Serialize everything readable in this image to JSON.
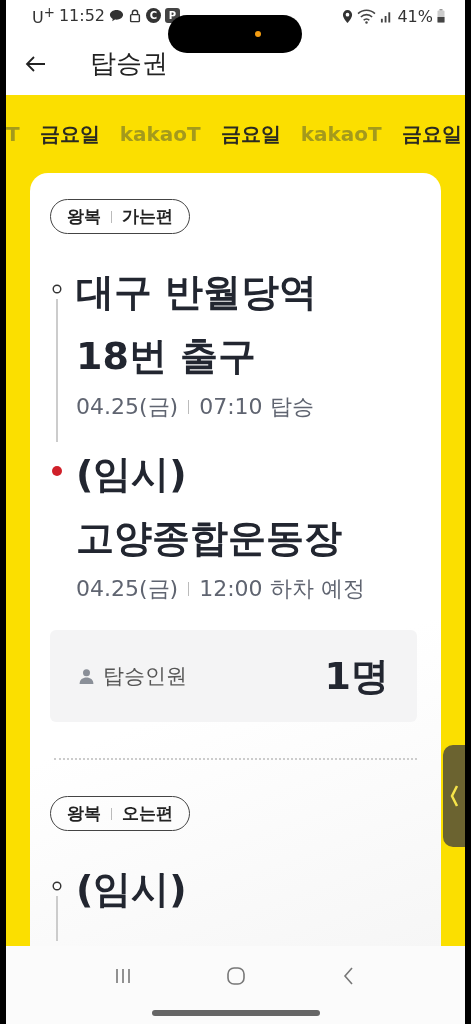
{
  "status_bar": {
    "carrier": "U$^{+}$",
    "time": "11:52",
    "app_badges": [
      "C",
      "P"
    ],
    "battery": "41%"
  },
  "header": {
    "title": "탑승권"
  },
  "marquee": [
    {
      "text": "T",
      "kind": "brand"
    },
    {
      "text": "금요일",
      "kind": "day"
    },
    {
      "text": "kakaoT",
      "kind": "brand"
    },
    {
      "text": "금요일",
      "kind": "day"
    },
    {
      "text": "kakaoT",
      "kind": "brand"
    },
    {
      "text": "금요일",
      "kind": "day"
    }
  ],
  "legs": [
    {
      "trip": "왕복",
      "direction": "가는편",
      "stops": [
        {
          "kind": "origin",
          "name": [
            "대구 반월당역",
            "18번 출구"
          ],
          "date": "04.25(금)",
          "time": "07:10 탑승"
        },
        {
          "kind": "destination",
          "name": [
            "(임시)",
            "고양종합운동장"
          ],
          "date": "04.25(금)",
          "time": "12:00 하차 예정"
        }
      ],
      "passengers": {
        "label": "탑승인원",
        "count": "1명"
      }
    },
    {
      "trip": "왕복",
      "direction": "오는편",
      "stops": [
        {
          "kind": "origin",
          "name": [
            "(임시)"
          ]
        }
      ]
    }
  ]
}
